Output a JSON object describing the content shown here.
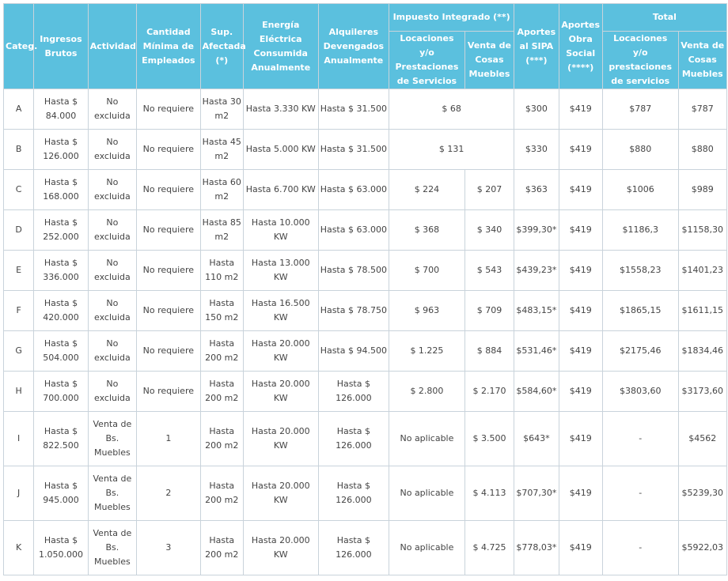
{
  "header": {
    "categ": "Categ.",
    "ingresos": "Ingresos Brutos",
    "actividad": "Actividad",
    "empleados": "Cantidad Mínima de Empleados",
    "superficie": "Sup. Afectada (*)",
    "energia": "Energía Eléctrica Consumida Anualmente",
    "alquileres": "Alquileres Devengados Anualmente",
    "impuesto": "Impuesto Integrado (**)",
    "imp_locaciones": "Locaciones y/o Prestaciones de Servicios",
    "imp_venta": "Venta de Cosas Muebles",
    "sipa": "Aportes al SIPA (***)",
    "obra_social": "Aportes Obra Social (****)",
    "total": "Total",
    "tot_locaciones": "Locaciones y/o prestaciones de servicios",
    "tot_venta": "Venta de Cosas Muebles"
  },
  "rows": [
    {
      "cat": "A",
      "ingresos": "Hasta $ 84.000",
      "actividad": "No excluida",
      "empleados": "No requiere",
      "sup": "Hasta 30 m2",
      "energia": "Hasta 3.330 KW",
      "alquileres": "Hasta $ 31.500",
      "imp": "$ 68",
      "sipa": "$300",
      "os": "$419",
      "tot_loc": "$787",
      "tot_venta": "$787"
    },
    {
      "cat": "B",
      "ingresos": "Hasta $ 126.000",
      "actividad": "No excluida",
      "empleados": "No requiere",
      "sup": "Hasta 45 m2",
      "energia": "Hasta 5.000 KW",
      "alquileres": "Hasta $ 31.500",
      "imp": "$ 131",
      "sipa": "$330",
      "os": "$419",
      "tot_loc": "$880",
      "tot_venta": "$880"
    },
    {
      "cat": "C",
      "ingresos": "Hasta $ 168.000",
      "actividad": "No excluida",
      "empleados": "No requiere",
      "sup": "Hasta 60 m2",
      "energia": "Hasta 6.700 KW",
      "alquileres": "Hasta $ 63.000",
      "imp_loc": "$ 224",
      "imp_venta": "$ 207",
      "sipa": "$363",
      "os": "$419",
      "tot_loc": "$1006",
      "tot_venta": "$989"
    },
    {
      "cat": "D",
      "ingresos": "Hasta $ 252.000",
      "actividad": "No excluida",
      "empleados": "No requiere",
      "sup": "Hasta 85 m2",
      "energia": "Hasta 10.000 KW",
      "alquileres": "Hasta $ 63.000",
      "imp_loc": "$ 368",
      "imp_venta": "$ 340",
      "sipa": "$399,30*",
      "os": "$419",
      "tot_loc": "$1186,3",
      "tot_venta": "$1158,30"
    },
    {
      "cat": "E",
      "ingresos": "Hasta $ 336.000",
      "actividad": "No excluida",
      "empleados": "No requiere",
      "sup": "Hasta 110 m2",
      "energia": "Hasta 13.000 KW",
      "alquileres": "Hasta $ 78.500",
      "imp_loc": "$ 700",
      "imp_venta": "$ 543",
      "sipa": "$439,23*",
      "os": "$419",
      "tot_loc": "$1558,23",
      "tot_venta": "$1401,23"
    },
    {
      "cat": "F",
      "ingresos": "Hasta $ 420.000",
      "actividad": "No excluida",
      "empleados": "No requiere",
      "sup": "Hasta 150 m2",
      "energia": "Hasta 16.500 KW",
      "alquileres": "Hasta $ 78.750",
      "imp_loc": "$ 963",
      "imp_venta": "$ 709",
      "sipa": "$483,15*",
      "os": "$419",
      "tot_loc": "$1865,15",
      "tot_venta": "$1611,15"
    },
    {
      "cat": "G",
      "ingresos": "Hasta $ 504.000",
      "actividad": "No excluida",
      "empleados": "No requiere",
      "sup": "Hasta 200 m2",
      "energia": "Hasta 20.000 KW",
      "alquileres": "Hasta $ 94.500",
      "imp_loc": "$ 1.225",
      "imp_venta": "$ 884",
      "sipa": "$531,46*",
      "os": "$419",
      "tot_loc": "$2175,46",
      "tot_venta": "$1834,46"
    },
    {
      "cat": "H",
      "ingresos": "Hasta $ 700.000",
      "actividad": "No excluida",
      "empleados": "No requiere",
      "sup": "Hasta 200 m2",
      "energia": "Hasta 20.000 KW",
      "alquileres": "Hasta $ 126.000",
      "imp_loc": "$ 2.800",
      "imp_venta": "$ 2.170",
      "sipa": "$584,60*",
      "os": "$419",
      "tot_loc": "$3803,60",
      "tot_venta": "$3173,60"
    },
    {
      "cat": "I",
      "ingresos": "Hasta $ 822.500",
      "actividad": "Venta de Bs. Muebles",
      "empleados": "1",
      "sup": "Hasta 200 m2",
      "energia": "Hasta 20.000 KW",
      "alquileres": "Hasta $ 126.000",
      "imp_loc": "No aplicable",
      "imp_venta": "$ 3.500",
      "sipa": "$643*",
      "os": "$419",
      "tot_loc": "-",
      "tot_venta": "$4562"
    },
    {
      "cat": "J",
      "ingresos": "Hasta $ 945.000",
      "actividad": "Venta de Bs. Muebles",
      "empleados": "2",
      "sup": "Hasta 200 m2",
      "energia": "Hasta 20.000 KW",
      "alquileres": "Hasta $ 126.000",
      "imp_loc": "No aplicable",
      "imp_venta": "$ 4.113",
      "sipa": "$707,30*",
      "os": "$419",
      "tot_loc": "-",
      "tot_venta": "$5239,30"
    },
    {
      "cat": "K",
      "ingresos": "Hasta $ 1.050.000",
      "actividad": "Venta de Bs. Muebles",
      "empleados": "3",
      "sup": "Hasta 200 m2",
      "energia": "Hasta 20.000 KW",
      "alquileres": "Hasta $ 126.000",
      "imp_loc": "No aplicable",
      "imp_venta": "$ 4.725",
      "sipa": "$778,03*",
      "os": "$419",
      "tot_loc": "-",
      "tot_venta": "$5922,03"
    }
  ]
}
